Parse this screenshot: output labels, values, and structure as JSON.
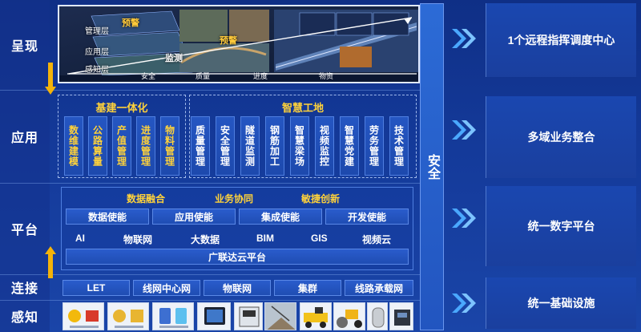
{
  "layers": {
    "display": "呈现",
    "application": "应用",
    "platform": "平台",
    "connect": "连接",
    "sense": "感知"
  },
  "screen": {
    "side_labels": [
      "管理层",
      "应用层",
      "感知层"
    ],
    "highlights": [
      "预警",
      "监测",
      "预警"
    ],
    "bottom_ticks": [
      "安全",
      "质量",
      "进度",
      "物资"
    ]
  },
  "application": {
    "group1_title": "基建一体化",
    "group1_items": [
      "数维建模",
      "公路算量",
      "产值管理",
      "进度管理",
      "物料管理"
    ],
    "group2_title": "智慧工地",
    "group2_items": [
      "质量管理",
      "安全管理",
      "隧道监测",
      "钢筋加工",
      "智慧梁场",
      "视频监控",
      "智慧党建",
      "劳务管理",
      "技术管理"
    ]
  },
  "platform": {
    "headlines": [
      "数据融合",
      "业务协同",
      "敏捷创新"
    ],
    "enablers": [
      "数据使能",
      "应用使能",
      "集成使能",
      "开发使能"
    ],
    "techs": [
      "AI",
      "物联网",
      "大数据",
      "BIM",
      "GIS",
      "视频云"
    ],
    "base": "广联达云平台"
  },
  "connect": {
    "items": [
      "LET",
      "线网中心网",
      "物联网",
      "集群",
      "线路承载网"
    ]
  },
  "security": "安全",
  "right_panels": [
    "1个远程指挥调度中心",
    "多域业务整合",
    "统一数字平台",
    "统一基础设施"
  ],
  "colors": {
    "background": "#143a9a",
    "accent_yellow": "#ffd23a",
    "arrow_yellow": "#f4b30a",
    "card_blue": "#2556c2",
    "chevron": "#4aa8ff"
  }
}
